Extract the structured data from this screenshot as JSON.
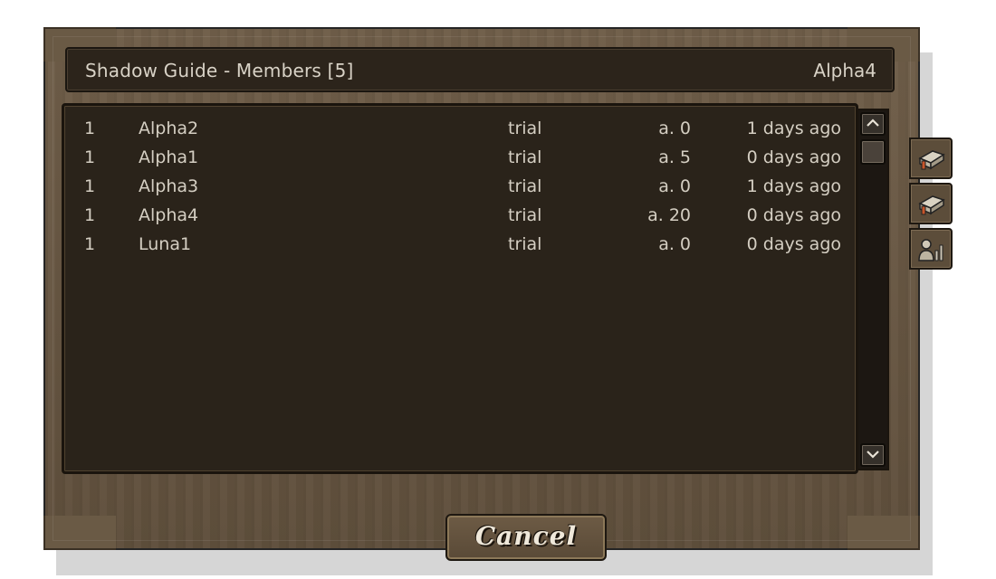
{
  "window": {
    "title": "Shadow Guide - Members [5]",
    "player": "Alpha4"
  },
  "members": [
    {
      "rank": "1",
      "name": "Alpha2",
      "rank_name": "trial",
      "activity": "a. 0",
      "last_seen": "1 days ago"
    },
    {
      "rank": "1",
      "name": "Alpha1",
      "rank_name": "trial",
      "activity": "a. 5",
      "last_seen": "0 days ago"
    },
    {
      "rank": "1",
      "name": "Alpha3",
      "rank_name": "trial",
      "activity": "a. 0",
      "last_seen": "1 days ago"
    },
    {
      "rank": "1",
      "name": "Alpha4",
      "rank_name": "trial",
      "activity": "a. 20",
      "last_seen": "0 days ago"
    },
    {
      "rank": "1",
      "name": "Luna1",
      "rank_name": "trial",
      "activity": "a. 0",
      "last_seen": "0 days ago"
    }
  ],
  "scrollbar": {
    "up_icon": "chevron-up-icon",
    "down_icon": "chevron-down-icon"
  },
  "side_tabs": [
    {
      "icon": "book-icon"
    },
    {
      "icon": "book-icon"
    },
    {
      "icon": "member-stats-icon"
    }
  ],
  "buttons": {
    "cancel": "Cancel"
  },
  "colors": {
    "panel": "#2a231a",
    "wood": "#6f5e49",
    "text": "#d4cec2"
  }
}
